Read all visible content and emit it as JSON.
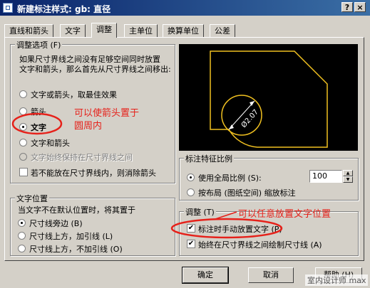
{
  "window": {
    "title": "新建标注样式: gb: 直径",
    "help_button": "?",
    "close_button": "×"
  },
  "tabs": [
    "直线和箭头",
    "文字",
    "调整",
    "主单位",
    "换算单位",
    "公差"
  ],
  "fit_options": {
    "title": "调整选项 (F)",
    "description_line1": "如果尺寸界线之间没有足够空间同时放置",
    "description_line2": "文字和箭头，那么首先从尺寸界线之间移出:",
    "options": [
      "文字或箭头，取最佳效果",
      "箭头",
      "文字",
      "文字和箭头",
      "文字始终保持在尺寸界线之间"
    ],
    "selected": "文字",
    "suppress_label": "若不能放在尺寸界线内，则消除箭头"
  },
  "annotation_1": "可以使箭头置于",
  "annotation_1b": "圆周内",
  "preview": {
    "dimension_text": "Ø2.07"
  },
  "scale": {
    "title": "标注特征比例",
    "use_global_label": "使用全局比例 (S):",
    "global_value": "100",
    "layout_label": "按布局 (图纸空间) 缩放标注"
  },
  "text_placement": {
    "title": "文字位置",
    "description": "当文字不在默认位置时，将其置于",
    "options": [
      "尺寸线旁边 (B)",
      "尺寸线上方，加引线 (L)",
      "尺寸线上方，不加引线 (O)"
    ],
    "selected": "尺寸线旁边 (B)"
  },
  "fine_tuning": {
    "title": "调整 (T)",
    "manual_label": "标注时手动放置文字 (P)",
    "manual_checked": true,
    "always_draw_label": "始终在尺寸界线之间绘制尺寸线 (A)",
    "always_draw_checked": true
  },
  "annotation_2": "可以任意放置文字位置",
  "buttons": {
    "ok": "确定",
    "cancel": "取消",
    "help": "帮助 (H)"
  },
  "watermark": "室内设计师 max",
  "colors": {
    "preview_line": "#f0c020",
    "annotation": "#e6211a",
    "titlebar": "#0a246a"
  }
}
